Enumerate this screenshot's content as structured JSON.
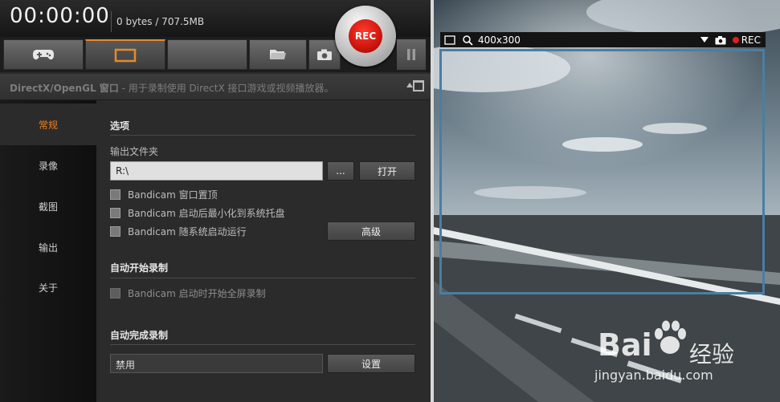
{
  "timer": "00:00:00",
  "filesize": "0 bytes / 707.5MB",
  "rec_button": "REC",
  "mode": {
    "title": "DirectX/OpenGL 窗口",
    "desc": " - 用于录制使用 DirectX 接口游戏或视频播放器。"
  },
  "sidebar": {
    "items": [
      {
        "label": "常规"
      },
      {
        "label": "录像"
      },
      {
        "label": "截图"
      },
      {
        "label": "输出"
      },
      {
        "label": "关于"
      }
    ]
  },
  "options": {
    "section_title": "选项",
    "output_folder_label": "输出文件夹",
    "output_folder_value": "R:\\",
    "browse_label": "...",
    "open_label": "打开",
    "check_topmost": "Bandicam 窗口置顶",
    "check_minimize_tray": "Bandicam 启动后最小化到系统托盘",
    "check_autostart": "Bandicam 随系统启动运行",
    "advanced_label": "高级"
  },
  "auto_start": {
    "section_title": "自动开始录制",
    "check_fullscreen": "Bandicam 启动时开始全屏录制"
  },
  "auto_finish": {
    "section_title": "自动完成录制",
    "value": "禁用",
    "settings_label": "设置"
  },
  "capture": {
    "size": "400x300",
    "rec": "REC"
  },
  "watermark": {
    "brand": "Bai",
    "brand2": "经验",
    "url": "jingyan.baidu.com"
  },
  "colors": {
    "accent_orange": "#e8892a",
    "rec_red": "#c8120a",
    "frame_blue": "#4a7ea3"
  }
}
